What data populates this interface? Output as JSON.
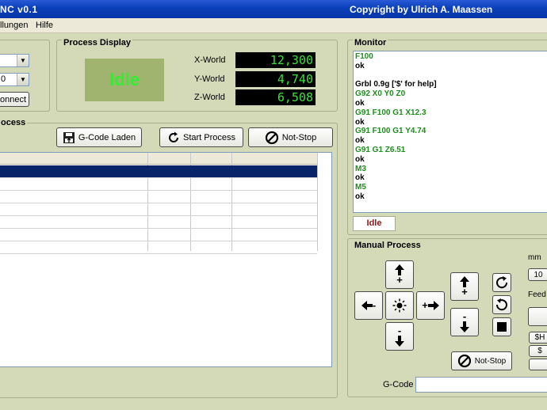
{
  "window": {
    "title": "NC  v0.1",
    "copyright": "Copyright by Ulrich A. Maassen"
  },
  "menu": {
    "items": [
      "llungen",
      "Hilfe"
    ]
  },
  "connection": {
    "combo1_value": "",
    "combo2_value": "0",
    "connect_label": "onnect"
  },
  "process_display": {
    "title": "Process Display",
    "status": "Idle",
    "x_label": "X-World",
    "x_value": "12,300",
    "y_label": "Y-World",
    "y_value": "4,740",
    "z_label": "Z-World",
    "z_value": "6,508"
  },
  "process": {
    "title": "ocess",
    "gcode_load_label": "G-Code Laden",
    "start_label": "Start Process",
    "notstop_label": "Not-Stop"
  },
  "monitor": {
    "title": "Monitor",
    "lines": [
      {
        "text": "F100",
        "color": "#1e8c1e"
      },
      {
        "text": "ok",
        "color": "#000000"
      },
      {
        "text": "",
        "color": "#000000"
      },
      {
        "text": "Grbl 0.9g ['$' for help]",
        "color": "#000000"
      },
      {
        "text": "G92 X0 Y0 Z0",
        "color": "#1e8c1e"
      },
      {
        "text": "ok",
        "color": "#000000"
      },
      {
        "text": "G91 F100 G1 X12.3",
        "color": "#1e8c1e"
      },
      {
        "text": "ok",
        "color": "#000000"
      },
      {
        "text": "G91 F100 G1 Y4.74",
        "color": "#1e8c1e"
      },
      {
        "text": "ok",
        "color": "#000000"
      },
      {
        "text": "G91 G1 Z6.51",
        "color": "#1e8c1e"
      },
      {
        "text": "ok",
        "color": "#000000"
      },
      {
        "text": "M3",
        "color": "#1e8c1e"
      },
      {
        "text": "ok",
        "color": "#000000"
      },
      {
        "text": "M5",
        "color": "#1e8c1e"
      },
      {
        "text": "ok",
        "color": "#000000"
      }
    ],
    "status": "Idle"
  },
  "manual": {
    "title": "Manual Process",
    "unit_label": "mm",
    "step_value": "10",
    "feed_label": "Feed",
    "sh_label": "$H",
    "dollar_label": "$",
    "plus": "+",
    "minus": "-",
    "notstop_label": "Not-Stop",
    "gcode_label": "G-Code"
  },
  "colors": {
    "title_bar": "#0a3fb8",
    "panel_bg": "#d4d9b8",
    "lcd_text": "#3ce03c",
    "idle_bg": "#a0b470",
    "selection": "#0a246a"
  }
}
